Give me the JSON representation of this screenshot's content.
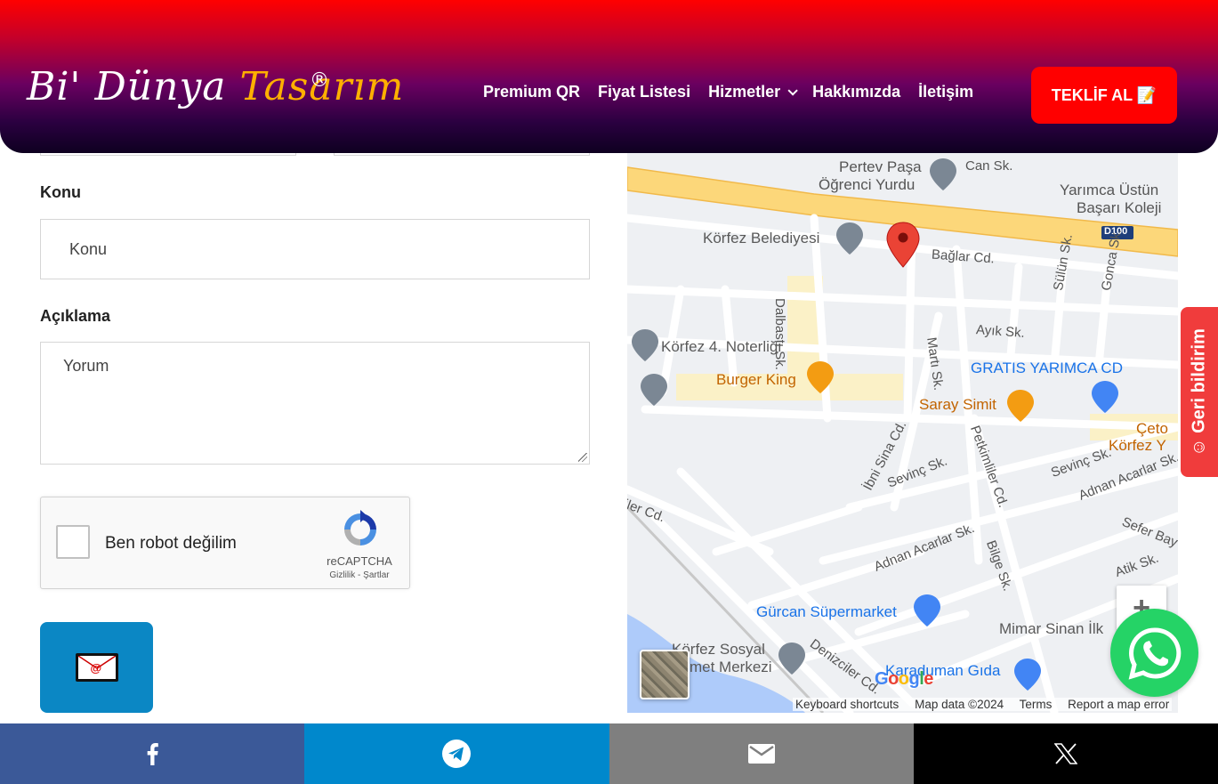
{
  "header": {
    "logo_text_1": "Bi' Dünya ",
    "logo_text_2": "Tasarım",
    "logo_reg": "®",
    "nav": [
      {
        "label": "Premium QR"
      },
      {
        "label": "Fiyat Listesi"
      },
      {
        "label": "Hizmetler"
      },
      {
        "label": "Hakkımızda"
      },
      {
        "label": "İletişim"
      }
    ],
    "cta_label": "TEKLİF AL 📝"
  },
  "form": {
    "subject_label": "Konu",
    "subject_placeholder": "Konu",
    "desc_label": "Açıklama",
    "desc_placeholder": "Yorum",
    "captcha_label": "Ben robot değilim",
    "captcha_brand": "reCAPTCHA",
    "captcha_links": "Gizlilik - Şartlar"
  },
  "map": {
    "labels": {
      "pertev": "Pertev Paşa",
      "ogrenci": "Öğrenci Yurdu",
      "can": "Can Sk.",
      "yarimca": "Yarımca Üstün",
      "basari": "Başarı Koleji",
      "korfez_bel": "Körfez Belediyesi",
      "baglar": "Bağlar Cd.",
      "d100": "D100",
      "dalbasti": "Dalbastı Sk.",
      "sulun": "Sülün Sk.",
      "gonca": "Gonca Sk.",
      "ayik": "Ayık Sk.",
      "noter": "Körfez 4. Noterliği",
      "marti": "Martı Sk.",
      "gratis": "GRATIS YARIMCA CD",
      "burger": "Burger King",
      "saray": "Saray Simit",
      "ibni": "İbni Sina Cd.",
      "sevinc1": "Sevinç Sk.",
      "sevinc2": "Sevinç Sk.",
      "petkim": "Petkimliler Cd.",
      "adnan1": "Adnan Acarlar Sk.",
      "adnan2": "Adnan Acarlar Sk.",
      "sefer": "Sefer Bay",
      "bilge": "Bilge Sk.",
      "atik": "Atik Sk.",
      "gurcan": "Gürcan Süpermarket",
      "mimar": "Mimar Sinan İlk",
      "sosyal1": "Körfez Sosyal",
      "sosyal2": "met Merkezi",
      "denizciler": "Denizciler Cd.",
      "karaduman": "Karaduman Gıda",
      "cet1": "Çeto",
      "cet2": "Körfez Y",
      "ilercd": "iler Cd."
    },
    "footer": [
      "Keyboard shortcuts",
      "Map data ©2024",
      "Terms",
      "Report a map error"
    ],
    "google": "Google",
    "zoom": "+"
  },
  "feedback_label": "Geri bildirim",
  "colors": {
    "accent_red": "#ff0000",
    "send_blue": "#0b87c4",
    "whatsapp": "#25d366",
    "facebook": "#3b5998",
    "telegram": "#0088cc",
    "email": "#7f7f7f",
    "x": "#000000"
  },
  "share": {
    "icons": [
      "facebook-icon",
      "telegram-icon",
      "email-icon",
      "x-icon"
    ]
  }
}
